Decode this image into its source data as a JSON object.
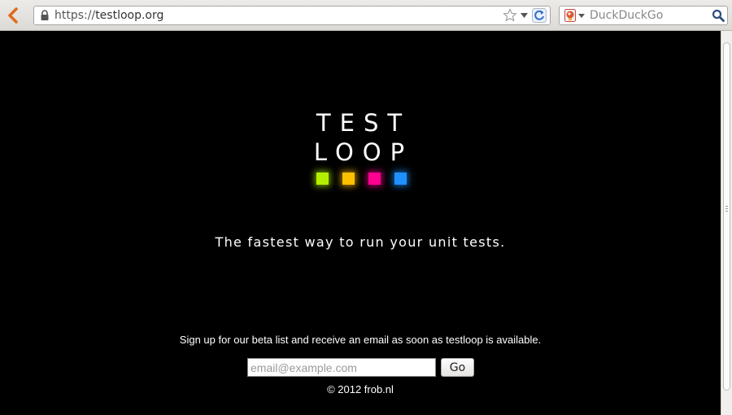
{
  "browser": {
    "url": {
      "scheme": "https://",
      "host": "testloop.org"
    },
    "search": {
      "placeholder": "DuckDuckGo"
    }
  },
  "page": {
    "logo": {
      "line1": "TEST",
      "line2": "LOOP",
      "squares": [
        "#b2f000",
        "#ffc000",
        "#ff0090",
        "#1e90ff"
      ]
    },
    "tagline": "The fastest way to run your unit tests.",
    "signup": {
      "text": "Sign up for our beta list and receive an email as soon as testloop is available.",
      "email_placeholder": "email@example.com",
      "submit_label": "Go"
    },
    "copyright": "© 2012 frob.nl"
  },
  "icons": [
    "back-icon",
    "lock-icon",
    "star-icon",
    "dropmarker-icon",
    "reload-icon",
    "search-engine-icon",
    "magnifier-icon"
  ]
}
